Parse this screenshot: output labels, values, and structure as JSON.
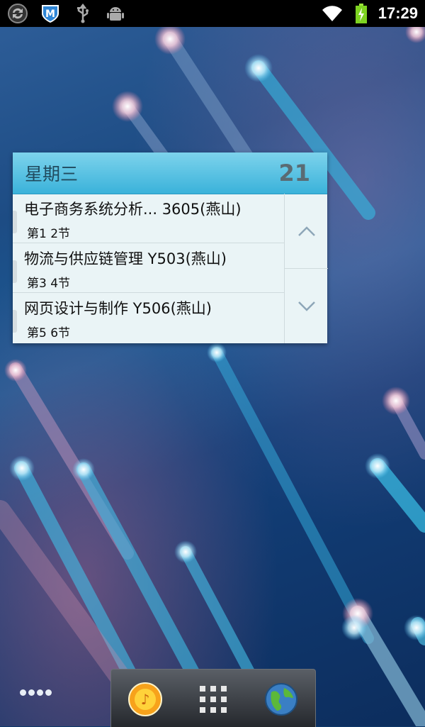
{
  "statusbar": {
    "left_icons": [
      "sync-icon",
      "mcafee-shield-icon",
      "usb-icon",
      "android-debug-icon"
    ],
    "right_icons": [
      "wifi-icon",
      "battery-charging-icon"
    ],
    "time": "17:29"
  },
  "widget": {
    "day": "星期三",
    "date": "21",
    "courses": [
      {
        "title": "电子商务系统分析...  3605(燕山)",
        "period": "第1 2节"
      },
      {
        "title": "物流与供应链管理  Y503(燕山)",
        "period": "第3 4节"
      },
      {
        "title": "网页设计与制作  Y506(燕山)",
        "period": "第5 6节"
      }
    ],
    "up_icon": "chevron-up-icon",
    "down_icon": "chevron-down-icon"
  },
  "dock": {
    "items": [
      "music-app-icon",
      "app-drawer-icon",
      "browser-globe-icon"
    ]
  },
  "colors": {
    "header": "#3ab2da",
    "widget_bg": "#eaf4f6",
    "statusbar": "#000000"
  }
}
